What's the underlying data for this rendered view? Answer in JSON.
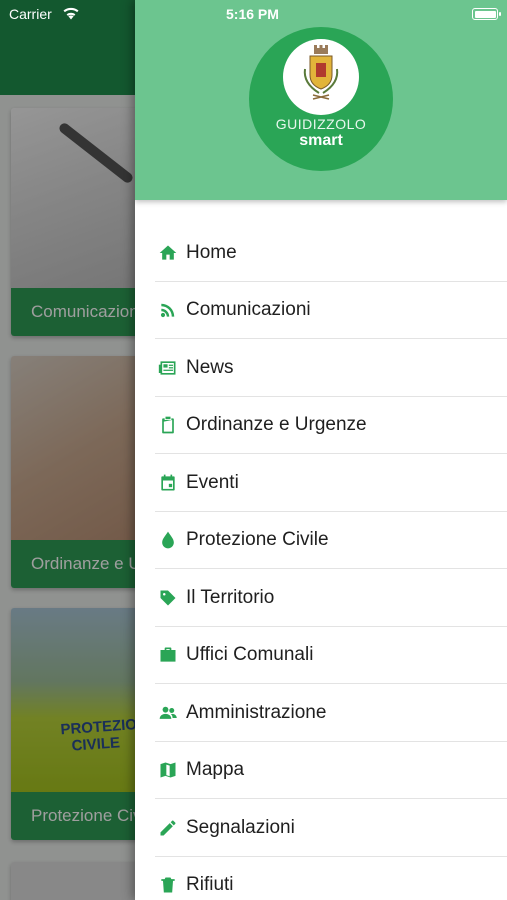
{
  "status_bar": {
    "carrier": "Carrier",
    "time": "5:16 PM"
  },
  "background_cards": [
    {
      "caption": "Comunicazioni"
    },
    {
      "caption": "Ordinanze e Urgenze"
    },
    {
      "caption": "Protezione Civile"
    }
  ],
  "background_photo_text": {
    "line1": "PROTEZIONE",
    "line2": "CIVILE"
  },
  "drawer": {
    "logo": {
      "line1": "GUIDIZZOLO",
      "line2": "smart"
    },
    "items": [
      {
        "label": "Home",
        "icon": "home-icon"
      },
      {
        "label": "Comunicazioni",
        "icon": "rss-icon"
      },
      {
        "label": "News",
        "icon": "newspaper-icon"
      },
      {
        "label": "Ordinanze e Urgenze",
        "icon": "clipboard-icon"
      },
      {
        "label": "Eventi",
        "icon": "calendar-icon"
      },
      {
        "label": "Protezione Civile",
        "icon": "drop-icon"
      },
      {
        "label": "Il Territorio",
        "icon": "tag-icon"
      },
      {
        "label": "Uffici Comunali",
        "icon": "briefcase-icon"
      },
      {
        "label": "Amministrazione",
        "icon": "people-icon"
      },
      {
        "label": "Mappa",
        "icon": "map-icon"
      },
      {
        "label": "Segnalazioni",
        "icon": "pencil-icon"
      },
      {
        "label": "Rifiuti",
        "icon": "trash-icon"
      }
    ]
  },
  "colors": {
    "primary_green": "#2aa556",
    "drawer_header": "#6cc58f",
    "app_header": "#1f8f4c"
  }
}
